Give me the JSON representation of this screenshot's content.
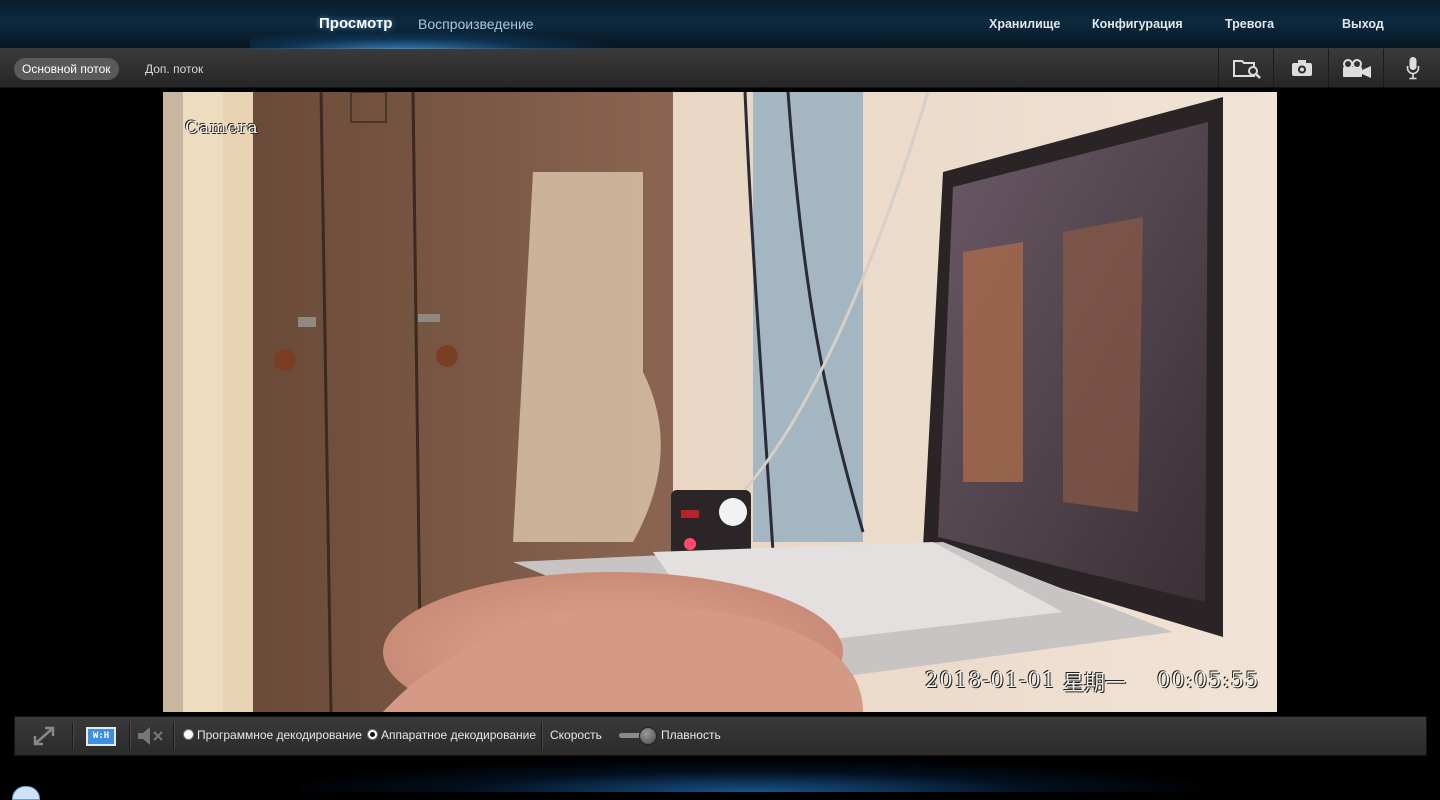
{
  "nav": {
    "active": "Просмотр",
    "playback": "Воспроизведение",
    "storage": "Хранилище",
    "config": "Конфигурация",
    "alarm": "Тревога",
    "logout": "Выход"
  },
  "streams": {
    "main": "Основной поток",
    "sub": "Доп. поток"
  },
  "toolbar_icons": [
    "folder-search-icon",
    "camera-snapshot-icon",
    "record-video-icon",
    "microphone-icon"
  ],
  "video": {
    "camera_label": "Camera",
    "datetime": "2018-01-01",
    "weekday": "星期一",
    "time": "00:05:55"
  },
  "controls": {
    "ratio_label": "W:H",
    "software_decode": "Программное декодирование",
    "hardware_decode": "Аппаратное декодирование",
    "speed_label": "Скорость",
    "smooth_label": "Плавность",
    "decode_selected": "hardware",
    "speed_level": 1.0
  },
  "colors": {
    "accent": "#4aa8ff",
    "nav_bg": "#0d2a40"
  }
}
